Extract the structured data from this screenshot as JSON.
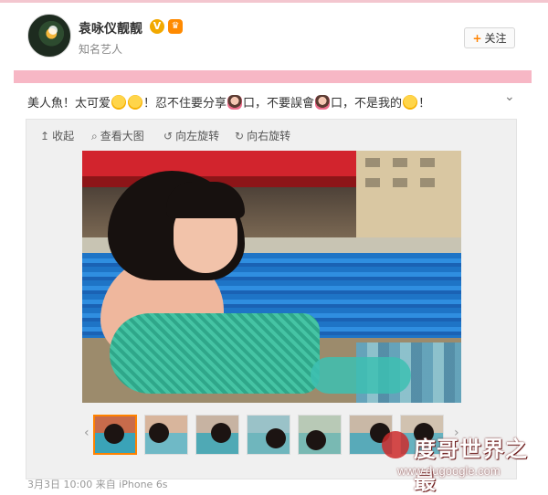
{
  "header": {
    "username": "袁咏仪靓靓",
    "subtitle": "知名艺人",
    "follow_label": "关注",
    "verified_badge": "V"
  },
  "post": {
    "text_parts": [
      "美人魚！太可爱",
      "！忍不住要分享",
      "口，不要誤會",
      "口，不是我的",
      "！"
    ],
    "more_icon": "chevron-down-icon"
  },
  "viewer_toolbar": {
    "collapse": "收起",
    "view_large": "查看大图",
    "rotate_left": "向左旋转",
    "rotate_right": "向右旋转"
  },
  "thumbnails": {
    "count": 7,
    "active_index": 0
  },
  "meta": {
    "time_source": "3月3日 10:00 来自 iPhone 6s"
  },
  "watermark": {
    "title": "度哥世界之最",
    "url": "www.dugoogle.com"
  },
  "colors": {
    "accent": "#ff8200",
    "pink_bar": "#f7b7c5",
    "badge": "#f2a900"
  }
}
